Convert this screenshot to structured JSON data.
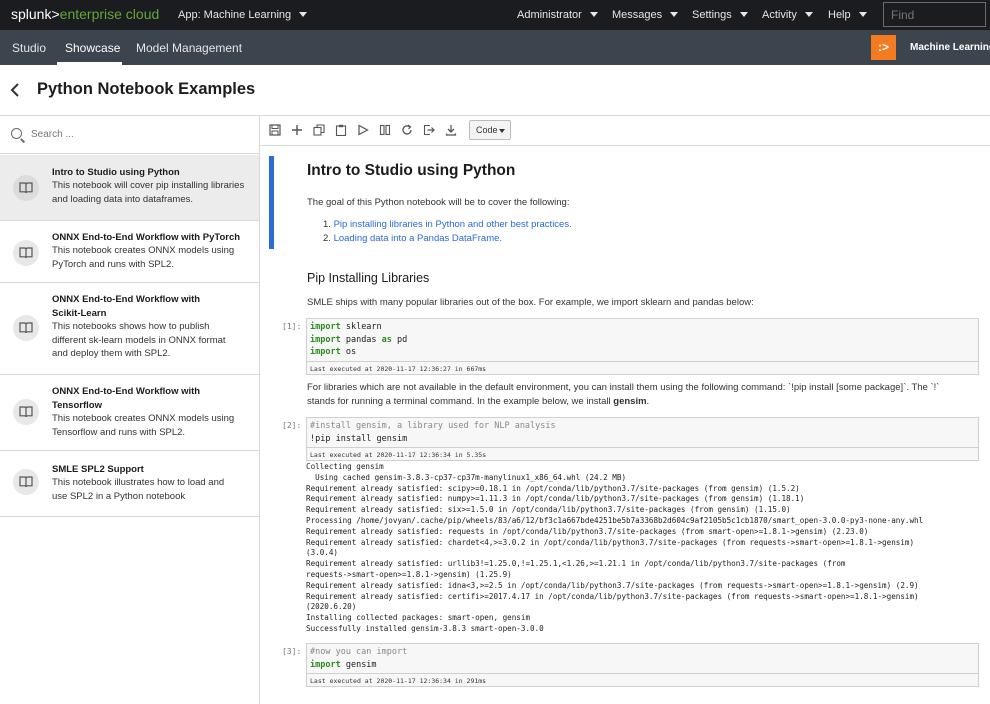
{
  "topbar": {
    "brand_splunk": "splunk>",
    "brand_product": "enterprise cloud",
    "app_label": "App: Machine Learning",
    "menus": [
      "Administrator",
      "Messages",
      "Settings",
      "Activity",
      "Help"
    ],
    "find_placeholder": "Find"
  },
  "subnav": {
    "tabs": [
      "Studio",
      "Showcase",
      "Model Management"
    ],
    "active_tab": "Showcase",
    "app_logo": ":>",
    "app_name": "Machine Learning"
  },
  "page": {
    "back_glyph": "‹",
    "title": "Python Notebook Examples"
  },
  "sidebar": {
    "search_placeholder": "Search ...",
    "items": [
      {
        "title": "Intro to Studio using Python",
        "description": "This notebook will cover pip installing libraries and loading data into dataframes.",
        "selected": true
      },
      {
        "title": "ONNX End-to-End Workflow with PyTorch",
        "description": "This notebook creates ONNX models using PyTorch and runs with SPL2."
      },
      {
        "title": "ONNX End-to-End Workflow with Scikit-Learn",
        "description": "This notebooks shows how to publish different sk-learn models in ONNX format and deploy them with SPL2."
      },
      {
        "title": "ONNX End-to-End Workflow with Tensorflow",
        "description": "This notebook creates ONNX models using Tensorflow and runs with SPL2."
      },
      {
        "title": "SMLE SPL2 Support",
        "description": "This notebook illustrates how to load and use SPL2 in a Python notebook"
      }
    ]
  },
  "toolbar": {
    "icons": [
      "save-icon",
      "add-cell-icon",
      "copy-icon",
      "paste-icon",
      "run-icon",
      "interrupt-icon",
      "restart-icon",
      "fast-forward-icon",
      "download-icon"
    ],
    "cell_type": "Code"
  },
  "notebook": {
    "title": "Intro to Studio using Python",
    "goal_text": "The goal of this Python notebook will be to cover the following:",
    "goals": [
      {
        "num": "1.",
        "text": "Pip installing libraries in Python and other best practices."
      },
      {
        "num": "2.",
        "text": "Loading data into a Pandas DataFrame."
      }
    ],
    "section_title": "Pip Installing Libraries",
    "section_text": "SMLE ships with many popular libraries out of the box. For example, we import sklearn and pandas below:",
    "cell1": {
      "prompt": "[1]:",
      "line1_kw": "import",
      "line1_rest": " sklearn",
      "line2_kw": "import",
      "line2_mid": " pandas ",
      "line2_kw2": "as",
      "line2_rest": " pd",
      "line3_kw": "import",
      "line3_rest": " os",
      "exec": "Last executed at 2020-11-17 12:36:27 in 667ms"
    },
    "para2_line1": "For libraries which are not available in the default environment, you can install them using the following command: `!pip install [some package]`. The `!`",
    "para2_line2a": "stands for running a terminal command. In the example below, we install ",
    "para2_line2b": "gensim",
    "para2_line2c": ".",
    "cell2": {
      "prompt": "[2]:",
      "comment": "#install gensim, a library used for NLP analysis",
      "line2": "!pip install gensim",
      "exec": "Last executed at 2020-11-17 12:36:34 in 5.35s"
    },
    "output2": [
      "Collecting gensim",
      "  Using cached gensim-3.8.3-cp37-cp37m-manylinux1_x86_64.whl (24.2 MB)",
      "Requirement already satisfied: scipy>=0.18.1 in /opt/conda/lib/python3.7/site-packages (from gensim) (1.5.2)",
      "Requirement already satisfied: numpy>=1.11.3 in /opt/conda/lib/python3.7/site-packages (from gensim) (1.18.1)",
      "Requirement already satisfied: six>=1.5.0 in /opt/conda/lib/python3.7/site-packages (from gensim) (1.15.0)",
      "Processing /home/jovyan/.cache/pip/wheels/83/a6/12/bf3c1a667bde4251be5b7a3368b2d604c9af2105b5c1cb1870/smart_open-3.0.0-py3-none-any.whl",
      "Requirement already satisfied: requests in /opt/conda/lib/python3.7/site-packages (from smart-open>=1.8.1->gensim) (2.23.0)",
      "Requirement already satisfied: chardet<4,>=3.0.2 in /opt/conda/lib/python3.7/site-packages (from requests->smart-open>=1.8.1->gensim)",
      "(3.0.4)",
      "Requirement already satisfied: urllib3!=1.25.0,!=1.25.1,<1.26,>=1.21.1 in /opt/conda/lib/python3.7/site-packages (from",
      "requests->smart-open>=1.8.1->gensim) (1.25.9)",
      "Requirement already satisfied: idna<3,>=2.5 in /opt/conda/lib/python3.7/site-packages (from requests->smart-open>=1.8.1->gensim) (2.9)",
      "Requirement already satisfied: certifi>=2017.4.17 in /opt/conda/lib/python3.7/site-packages (from requests->smart-open>=1.8.1->gensim)",
      "(2020.6.20)",
      "Installing collected packages: smart-open, gensim",
      "Successfully installed gensim-3.8.3 smart-open-3.0.0"
    ],
    "cell3": {
      "prompt": "[3]:",
      "comment": "#now you can import",
      "line2_kw": "import",
      "line2_rest": " gensim",
      "exec": "Last executed at 2020-11-17 12:36:34 in 291ms"
    }
  }
}
